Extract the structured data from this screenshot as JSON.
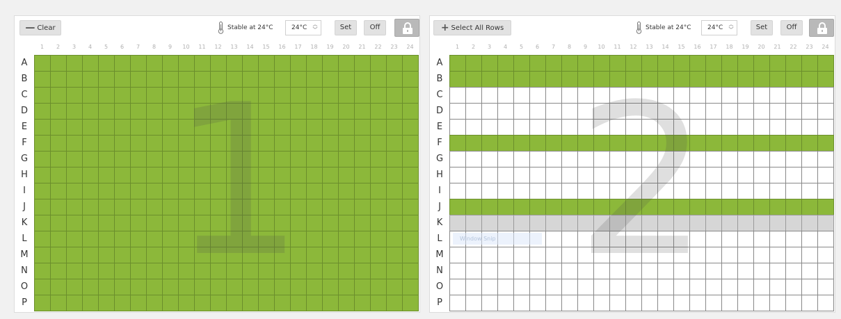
{
  "colors": {
    "selected": "#8cb83a",
    "highlighted": "#d6d6d6",
    "empty": "#ffffff"
  },
  "grid": {
    "rows": [
      "A",
      "B",
      "C",
      "D",
      "E",
      "F",
      "G",
      "H",
      "I",
      "J",
      "K",
      "L",
      "M",
      "N",
      "O",
      "P"
    ],
    "columns": [
      "1",
      "2",
      "3",
      "4",
      "5",
      "6",
      "7",
      "8",
      "9",
      "10",
      "11",
      "12",
      "13",
      "14",
      "15",
      "16",
      "17",
      "18",
      "19",
      "20",
      "21",
      "22",
      "23",
      "24"
    ]
  },
  "panels": [
    {
      "plate_number": "1",
      "primary_action": {
        "label": "Clear",
        "icon": "minus-icon"
      },
      "status": "Stable at 24°C",
      "temperature": "24°C",
      "set_label": "Set",
      "off_label": "Off",
      "lock_icon": "lock-icon",
      "selected_rows": [
        "A",
        "B",
        "C",
        "D",
        "E",
        "F",
        "G",
        "H",
        "I",
        "J",
        "K",
        "L",
        "M",
        "N",
        "O",
        "P"
      ],
      "highlighted_rows": [],
      "tooltip": ""
    },
    {
      "plate_number": "2",
      "primary_action": {
        "label": "Select All Rows",
        "icon": "plus-icon"
      },
      "status": "Stable at 24°C",
      "temperature": "24°C",
      "set_label": "Set",
      "off_label": "Off",
      "lock_icon": "lock-icon",
      "selected_rows": [
        "A",
        "B",
        "F",
        "J"
      ],
      "highlighted_rows": [
        "K"
      ],
      "tooltip": "Window Snip"
    }
  ]
}
